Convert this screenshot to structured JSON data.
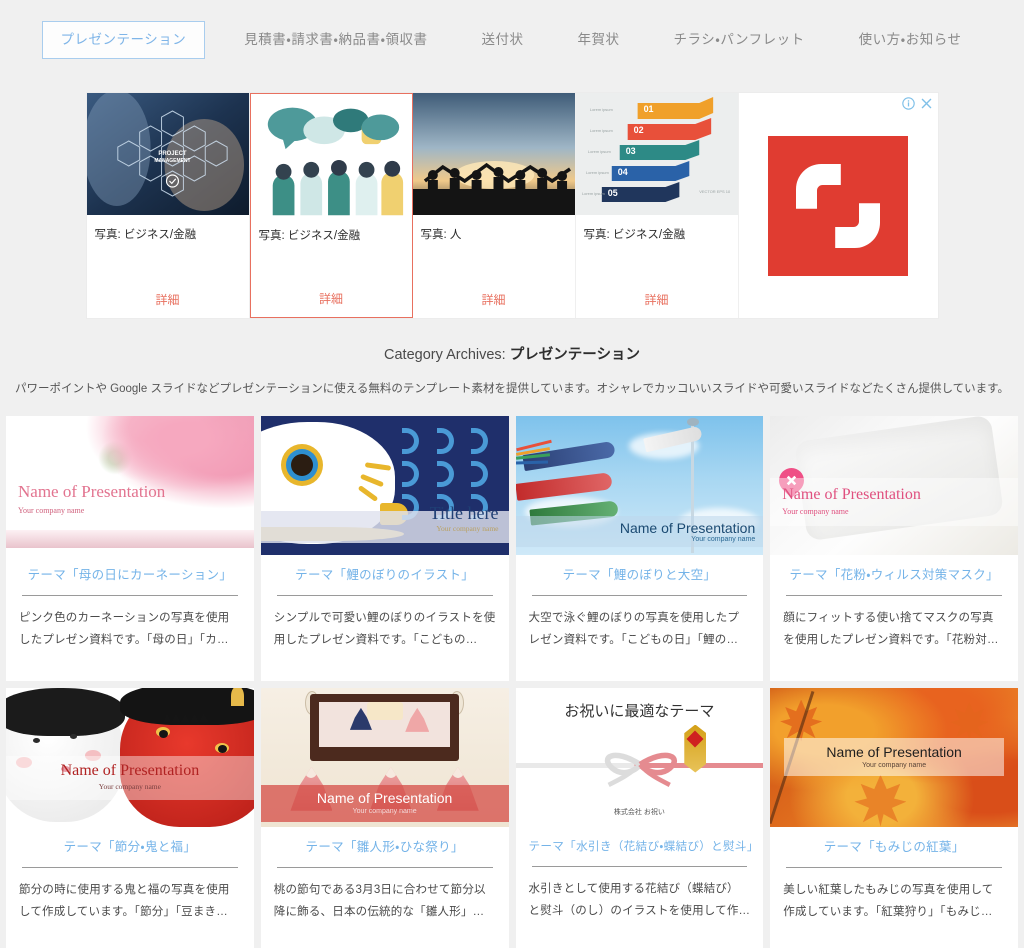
{
  "nav": {
    "items": [
      {
        "label": "プレゼンテーション",
        "active": true
      },
      {
        "label": "見積書・請求書・納品書・領収書",
        "active": false
      },
      {
        "label": "送付状",
        "active": false
      },
      {
        "label": "年賀状",
        "active": false
      },
      {
        "label": "チラシ・パンフレット",
        "active": false
      },
      {
        "label": "使い方・お知らせ",
        "active": false
      }
    ]
  },
  "ad": {
    "brand": "shutterstock",
    "info_icon": "info-circle-icon",
    "close_icon": "close-x-icon",
    "cards": [
      {
        "caption": "写真: ビジネス/金融",
        "cta": "詳細",
        "selected": false
      },
      {
        "caption": "写真: ビジネス/金融",
        "cta": "詳細",
        "selected": true
      },
      {
        "caption": "写真: 人",
        "cta": "詳細",
        "selected": false
      },
      {
        "caption": "写真: ビジネス/金融",
        "cta": "詳細",
        "selected": false
      }
    ]
  },
  "category": {
    "prefix": "Category Archives: ",
    "name": "プレゼンテーション",
    "description": "パワーポイントや Google スライドなどプレゼンテーションに使える無料のテンプレート素材を提供しています。オシャレでカッコいいスライドや可愛いスライドなどたくさん提供しています。"
  },
  "cards": [
    {
      "title": "テーマ「母の日にカーネーション」",
      "excerpt": "ピンク色のカーネーションの写真を使用したプレゼン資料です。「母の日」「カ…",
      "slide_title": "Name of Presentation",
      "slide_sub": "Your company name",
      "theme": "carnation"
    },
    {
      "title": "テーマ「鯉のぼりのイラスト」",
      "excerpt": "シンプルで可愛い鯉のぼりのイラストを使用したプレゼン資料です。「こどもの…",
      "slide_title": "Title here",
      "slide_sub": "Your company name",
      "theme": "koinobori-illustration"
    },
    {
      "title": "テーマ「鯉のぼりと大空」",
      "excerpt": "大空で泳ぐ鯉のぼりの写真を使用したプレゼン資料です。「こどもの日」「鯉の…",
      "slide_title": "Name of Presentation",
      "slide_sub": "Your company name",
      "theme": "koinobori-sky"
    },
    {
      "title": "テーマ「花粉・ウィルス対策マスク」",
      "excerpt": "顔にフィットする使い捨てマスクの写真を使用したプレゼン資料です。「花粉対…",
      "slide_title": "Name of Presentation",
      "slide_sub": "Your company name",
      "theme": "mask"
    },
    {
      "title": "テーマ「節分・鬼と福」",
      "excerpt": "節分の時に使用する鬼と福の写真を使用して作成しています。「節分」「豆まき…",
      "slide_title": "Name of Presentation",
      "slide_sub": "Your company name",
      "theme": "setsubun"
    },
    {
      "title": "テーマ「雛人形・ひな祭り」",
      "excerpt": "桃の節句である3月3日に合わせて節分以降に飾る、日本の伝統的な「雛人形」…",
      "slide_title": "Name of Presentation",
      "slide_sub": "Your company name",
      "theme": "hinamatsuri"
    },
    {
      "title": "テーマ「水引き（花結び・蝶結び）と熨斗」",
      "excerpt": "水引きとして使用する花結び（蝶結び）と熨斗（のし）のイラストを使用して作…",
      "slide_title": "お祝いに最適なテーマ",
      "slide_sub": "株式会社 お祝い",
      "theme": "mizuhiki"
    },
    {
      "title": "テーマ「もみじの紅葉」",
      "excerpt": "美しい紅葉したもみじの写真を使用して作成しています。「紅葉狩り」「もみじ…",
      "slide_title": "Name of Presentation",
      "slide_sub": "Your company name",
      "theme": "momiji"
    }
  ],
  "colors": {
    "page_bg": "#f0f0f0",
    "accent_blue": "#74b3e8",
    "accent_red": "#e8705f",
    "shutterstock_red": "#e03c31"
  }
}
